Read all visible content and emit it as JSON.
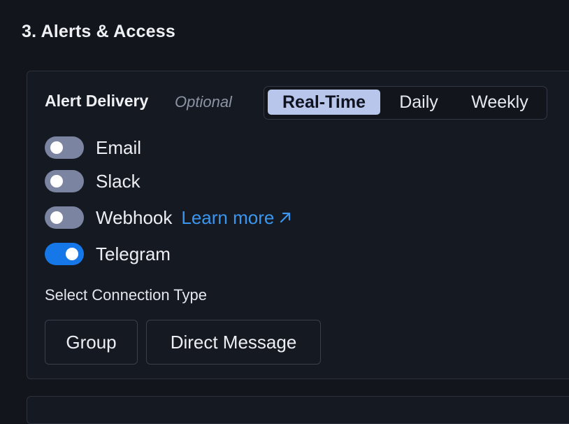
{
  "section": {
    "title": "3. Alerts & Access"
  },
  "delivery": {
    "label": "Alert Delivery",
    "optional": "Optional",
    "frequency": {
      "options": [
        "Real-Time",
        "Daily",
        "Weekly"
      ],
      "selected": "Real-Time"
    }
  },
  "channels": [
    {
      "label": "Email",
      "enabled": false
    },
    {
      "label": "Slack",
      "enabled": false
    },
    {
      "label": "Webhook",
      "enabled": false,
      "link": "Learn more"
    },
    {
      "label": "Telegram",
      "enabled": true
    }
  ],
  "connection": {
    "label": "Select Connection Type",
    "options": [
      "Group",
      "Direct Message"
    ]
  },
  "colors": {
    "background": "#12151c",
    "card": "#151922",
    "accent_blue": "#1677e8",
    "link_blue": "#3a96ee",
    "segment_active": "#b9c6ec",
    "toggle_off": "#7b84a0"
  },
  "icons": {
    "learn_more": "arrow-up-right-icon"
  }
}
